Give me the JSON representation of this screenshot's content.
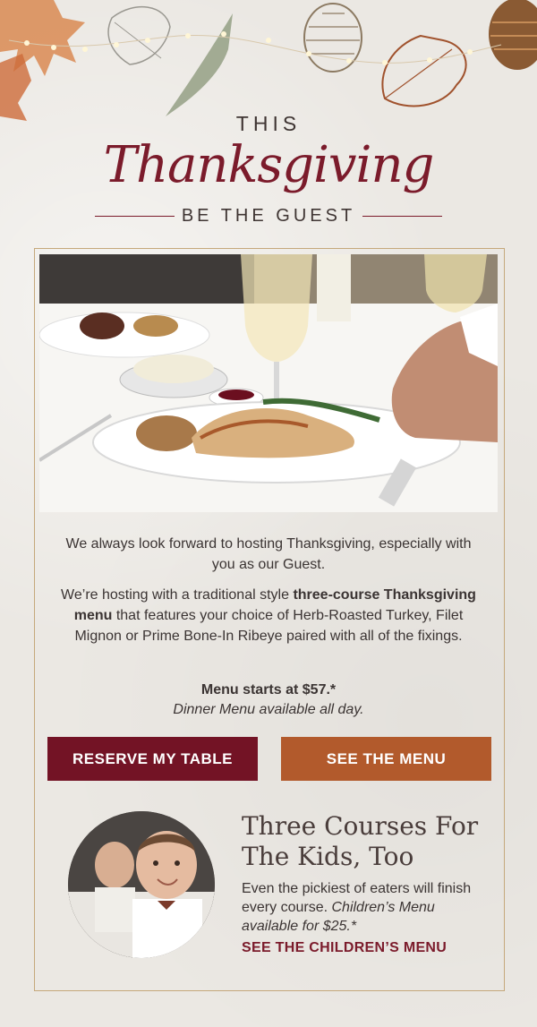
{
  "header": {
    "eyebrow": "THIS",
    "title": "Thanksgiving",
    "subtitle": "BE THE GUEST"
  },
  "intro": {
    "paragraph1": "We always look forward to hosting Thanksgiving, especially with you as our Guest.",
    "paragraph2_html": "We’re hosting with a traditional style <b>three-course Thanksgiving menu</b> that features your choice of Herb-Roasted Turkey, Filet Mignon or Prime Bone-In Ribeye paired with all of the fixings.",
    "price": "Menu starts at $57.*",
    "availability": "Dinner Menu available all day."
  },
  "buttons": {
    "reserve": "RESERVE MY TABLE",
    "menu": "SEE THE MENU"
  },
  "kids": {
    "title": "Three Courses For The Kids, Too",
    "text_html": "Even the pickiest of eaters will finish every course. <i>Children’s Menu available for $25.*</i>",
    "link": "SEE THE CHILDREN’S MENU"
  },
  "colors": {
    "burgundy": "#731325",
    "rust": "#b25a2c",
    "background": "#ebe8e3",
    "border_gold": "#c5a87b"
  },
  "icons": [
    "leaf-icon",
    "pinecone-icon",
    "string-lights-icon"
  ]
}
